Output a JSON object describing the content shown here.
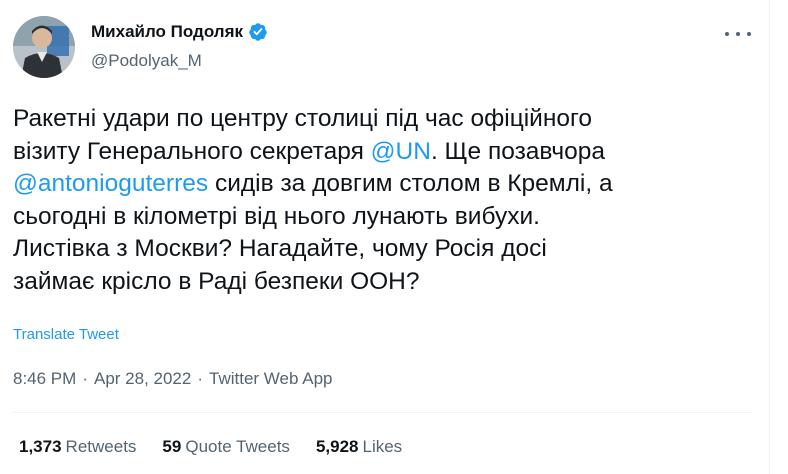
{
  "author": {
    "name": "Михайло Подоляк",
    "handle": "@Podolyak_M",
    "verified": true
  },
  "tweet": {
    "line1": "Ракетні удари по центру столиці під час офіційного",
    "line2_pre": "візиту Генерального секретаря ",
    "line2_mention": "@UN",
    "line2_post": ". Ще позавчора",
    "line3_mention": "@antonioguterres",
    "line3_post": " сидів за довгим столом в Кремлі, а",
    "line4": "сьогодні в кілометрі від нього лунають вибухи.",
    "line5": "Листівка з Москви? Нагадайте, чому Росія досі",
    "line6": "займає крісло в Раді безпеки ООН?"
  },
  "translate_label": "Translate Tweet",
  "meta": {
    "time": "8:46 PM",
    "separator": "·",
    "date": "Apr 28, 2022",
    "source": "Twitter Web App"
  },
  "stats": {
    "retweets_count": "1,373",
    "retweets_label": "Retweets",
    "quotes_count": "59",
    "quotes_label": "Quote Tweets",
    "likes_count": "5,928",
    "likes_label": "Likes"
  },
  "colors": {
    "link": "#1d9bf0",
    "secondary_text": "#536471",
    "primary_text": "#0f1419",
    "verified_badge": "#1d9bf0"
  },
  "icons": {
    "verified": "verified-badge-icon",
    "more": "more-options-icon"
  }
}
